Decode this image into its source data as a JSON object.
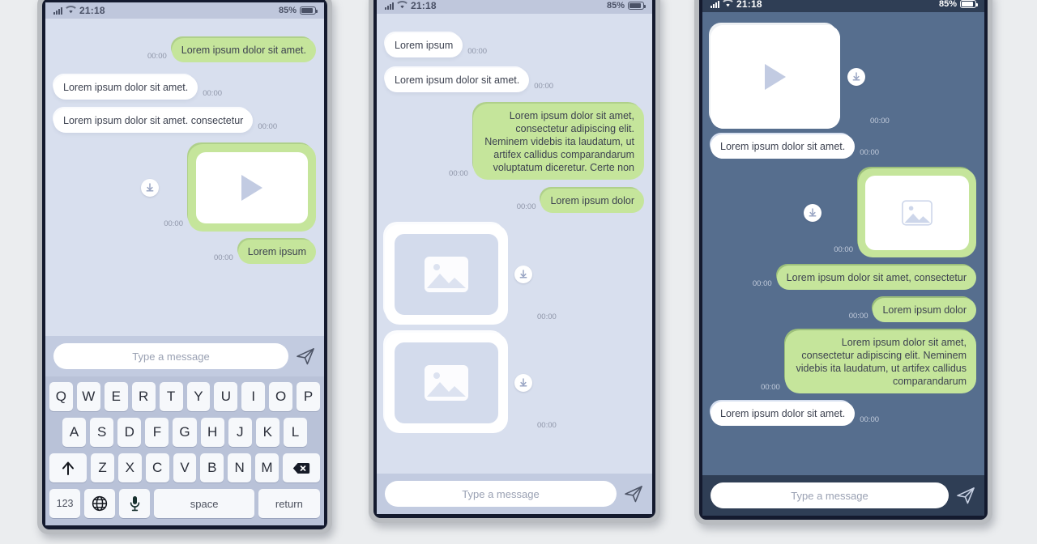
{
  "status_bar": {
    "time": "21:18",
    "battery_percent": "85%",
    "signal_icon": "signal-bars-icon",
    "wifi_icon": "wifi-icon",
    "battery_icon": "battery-icon"
  },
  "common": {
    "timestamp": "00:00",
    "input_placeholder": "Type a message",
    "send_icon": "send-paper-plane-icon",
    "download_icon": "download-arrow-icon",
    "play_icon": "play-triangle-icon",
    "image_icon": "image-placeholder-icon"
  },
  "colors": {
    "bubble_outgoing": "#c5e59b",
    "bubble_incoming": "#ffffff",
    "chat_bg_light": "#d8dfee",
    "chat_bg_dark": "#566e8e",
    "statusbar_light": "#bfc7dc",
    "statusbar_dark": "#2f3e55",
    "inputbar_light": "#c2cbe0",
    "inputbar_dark": "#2f3e55",
    "phone_frame": "#b9bcc0",
    "phone_bezel": "#141a2e"
  },
  "phone1": {
    "theme": "light",
    "messages": [
      {
        "side": "out",
        "kind": "text",
        "text": "Lorem ipsum dolor sit amet.",
        "time": "00:00"
      },
      {
        "side": "in",
        "kind": "text",
        "text": "Lorem ipsum dolor sit amet.",
        "time": "00:00"
      },
      {
        "side": "in",
        "kind": "text",
        "text": "Lorem ipsum dolor sit amet. consectetur",
        "time": "00:00"
      },
      {
        "side": "out",
        "kind": "video",
        "text": "",
        "time": "00:00"
      },
      {
        "side": "out",
        "kind": "text",
        "text": "Lorem ipsum",
        "time": "00:00"
      }
    ],
    "keyboard": {
      "row1": [
        "Q",
        "W",
        "E",
        "R",
        "T",
        "Y",
        "U",
        "I",
        "O",
        "P"
      ],
      "row2": [
        "A",
        "S",
        "D",
        "F",
        "G",
        "H",
        "J",
        "K",
        "L"
      ],
      "row3_shift": "shift-up-arrow-icon",
      "row3": [
        "Z",
        "X",
        "C",
        "V",
        "B",
        "N",
        "M"
      ],
      "row3_backspace": "backspace-delete-icon",
      "row4_numbers": "123",
      "row4_globe": "globe-language-icon",
      "row4_mic": "microphone-icon",
      "row4_space": "space",
      "row4_return": "return"
    }
  },
  "phone2": {
    "theme": "light",
    "messages": [
      {
        "side": "in",
        "kind": "text",
        "text": "Lorem ipsum",
        "time": "00:00"
      },
      {
        "side": "in",
        "kind": "text",
        "text": "Lorem ipsum dolor sit amet.",
        "time": "00:00"
      },
      {
        "side": "out",
        "kind": "text",
        "text": "Lorem ipsum dolor sit amet, consectetur adipiscing elit. Neminem videbis ita laudatum, ut artifex callidus comparandarum voluptatum diceretur. Certe non",
        "time": "00:00"
      },
      {
        "side": "out",
        "kind": "text",
        "text": "Lorem ipsum dolor",
        "time": "00:00"
      },
      {
        "side": "in",
        "kind": "image",
        "text": "",
        "time": "00:00"
      },
      {
        "side": "in",
        "kind": "image",
        "text": "",
        "time": "00:00"
      }
    ]
  },
  "phone3": {
    "theme": "dark",
    "messages": [
      {
        "side": "in",
        "kind": "video",
        "text": "",
        "time": "00:00"
      },
      {
        "side": "in",
        "kind": "text",
        "text": "Lorem ipsum dolor sit amet.",
        "time": "00:00"
      },
      {
        "side": "out",
        "kind": "image",
        "text": "",
        "time": "00:00"
      },
      {
        "side": "out",
        "kind": "text",
        "text": "Lorem ipsum dolor sit amet, consectetur",
        "time": "00:00"
      },
      {
        "side": "out",
        "kind": "text",
        "text": "Lorem ipsum dolor",
        "time": "00:00"
      },
      {
        "side": "out",
        "kind": "text",
        "text": "Lorem ipsum dolor sit amet, consectetur adipiscing elit. Neminem videbis ita laudatum, ut artifex callidus comparandarum",
        "time": "00:00"
      },
      {
        "side": "in",
        "kind": "text",
        "text": "Lorem ipsum dolor sit amet.",
        "time": "00:00"
      }
    ]
  }
}
